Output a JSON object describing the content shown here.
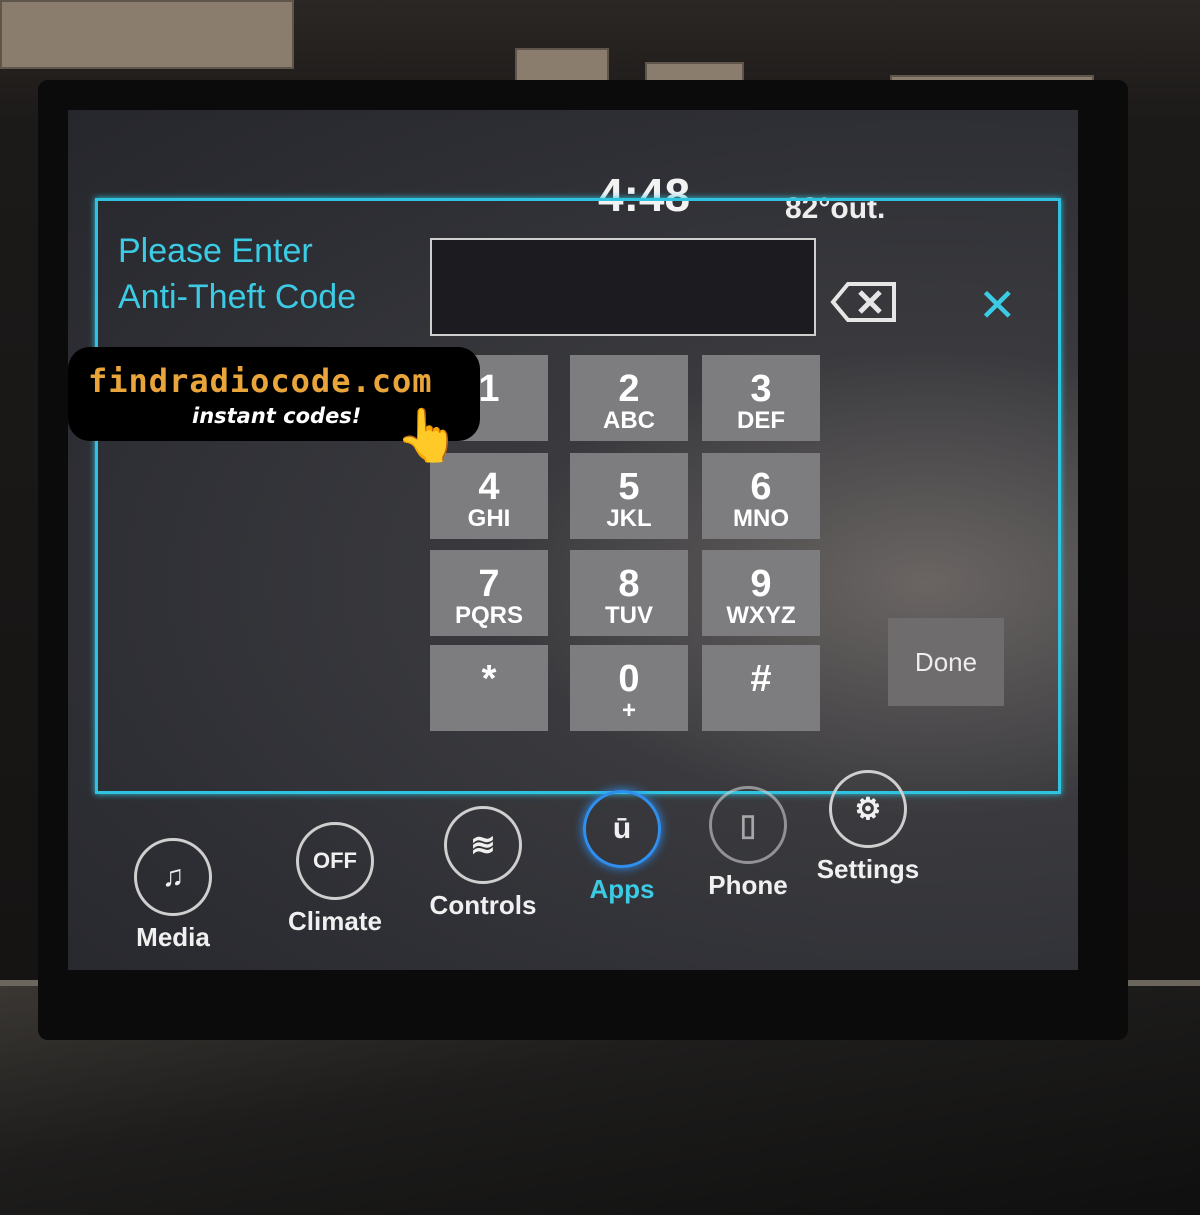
{
  "status_bar": {
    "time": "4:48",
    "temperature": "82°out."
  },
  "dialog": {
    "title_line1": "Please Enter",
    "title_line2": "Anti-Theft Code",
    "code_value": "",
    "backspace_icon": "backspace-icon",
    "close_icon": "close-icon",
    "close_glyph": "✕",
    "keys": [
      {
        "digit": "1",
        "letters": ""
      },
      {
        "digit": "2",
        "letters": "ABC"
      },
      {
        "digit": "3",
        "letters": "DEF"
      },
      {
        "digit": "4",
        "letters": "GHI"
      },
      {
        "digit": "5",
        "letters": "JKL"
      },
      {
        "digit": "6",
        "letters": "MNO"
      },
      {
        "digit": "7",
        "letters": "PQRS"
      },
      {
        "digit": "8",
        "letters": "TUV"
      },
      {
        "digit": "9",
        "letters": "WXYZ"
      },
      {
        "digit": "*",
        "letters": ""
      },
      {
        "digit": "0",
        "letters": "+"
      },
      {
        "digit": "#",
        "letters": ""
      }
    ],
    "done_label": "Done"
  },
  "nav": [
    {
      "label": "Media",
      "icon": "music-note-icon",
      "glyph": "♫"
    },
    {
      "label": "Climate",
      "icon": "climate-off-icon",
      "glyph": "OFF"
    },
    {
      "label": "Controls",
      "icon": "seat-heat-icon",
      "glyph": "≋"
    },
    {
      "label": "Apps",
      "icon": "uconnect-icon",
      "glyph": "ū",
      "active": true
    },
    {
      "label": "Phone",
      "icon": "phone-icon",
      "glyph": "▯"
    },
    {
      "label": "Settings",
      "icon": "gear-icon",
      "glyph": "⚙"
    }
  ],
  "promo": {
    "url": "findradiocode.com",
    "tagline": "instant codes!"
  },
  "colors": {
    "accent": "#2fc3df",
    "promo_orange": "#e9a43a",
    "key_bg": "#7d7d80"
  }
}
